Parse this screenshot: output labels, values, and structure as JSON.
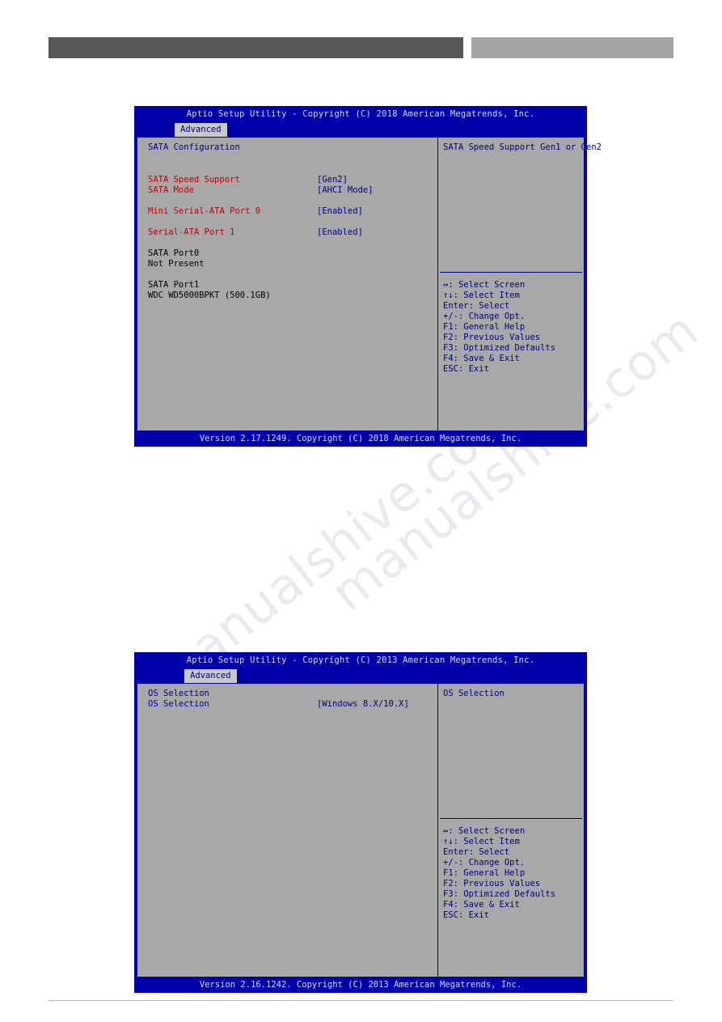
{
  "page": {
    "watermark_lines": [
      "manualshive.com",
      "manualshive.com"
    ]
  },
  "screens": [
    {
      "title": "Aptio Setup Utility - Copyright (C) 2018 American Megatrends, Inc.",
      "tab": "Advanced",
      "section_heading": "SATA Configuration",
      "rows": [
        {
          "label": "SATA Speed Support",
          "value": "[Gen2]",
          "style": "item"
        },
        {
          "label": "SATA Mode",
          "value": "[AHCI Mode]",
          "style": "item"
        },
        {
          "label": "Mini Serial-ATA Port 0",
          "value": "[Enabled]",
          "style": "item"
        },
        {
          "label": "Serial-ATA Port 1",
          "value": "[Enabled]",
          "style": "item"
        },
        {
          "label": "SATA Port0",
          "value": "",
          "style": "plain"
        },
        {
          "label": "Not Present",
          "value": "",
          "style": "plain"
        },
        {
          "label": "SATA Port1",
          "value": "",
          "style": "plain"
        },
        {
          "label": "WDC WD5000BPKT (500.1GB)",
          "value": "",
          "style": "plain"
        }
      ],
      "help_title": "SATA Speed Support Gen1 or Gen2",
      "help_keys": [
        "↔: Select Screen",
        "↑↓: Select Item",
        "Enter: Select",
        "+/-: Change Opt.",
        "F1: General Help",
        "F2: Previous Values",
        "F3: Optimized Defaults",
        "F4: Save & Exit",
        "ESC: Exit"
      ],
      "footer": "Version 2.17.1249. Copyright (C) 2018 American Megatrends, Inc."
    },
    {
      "title": "Aptio Setup Utility - Copyright (C) 2013 American Megatrends, Inc.",
      "tab": "Advanced",
      "section_heading": "OS Selection",
      "rows": [
        {
          "label": "OS Selection",
          "value": "[Windows 8.X/10.X]",
          "style": "item"
        }
      ],
      "help_title": "OS Selection",
      "help_keys": [
        "↔: Select Screen",
        "↑↓: Select Item",
        "Enter: Select",
        "+/-: Change Opt.",
        "F1: General Help",
        "F2: Previous Values",
        "F3: Optimized Defaults",
        "F4: Save & Exit",
        "ESC: Exit"
      ],
      "footer": "Version 2.16.1242. Copyright (C) 2013 American Megatrends, Inc."
    }
  ]
}
